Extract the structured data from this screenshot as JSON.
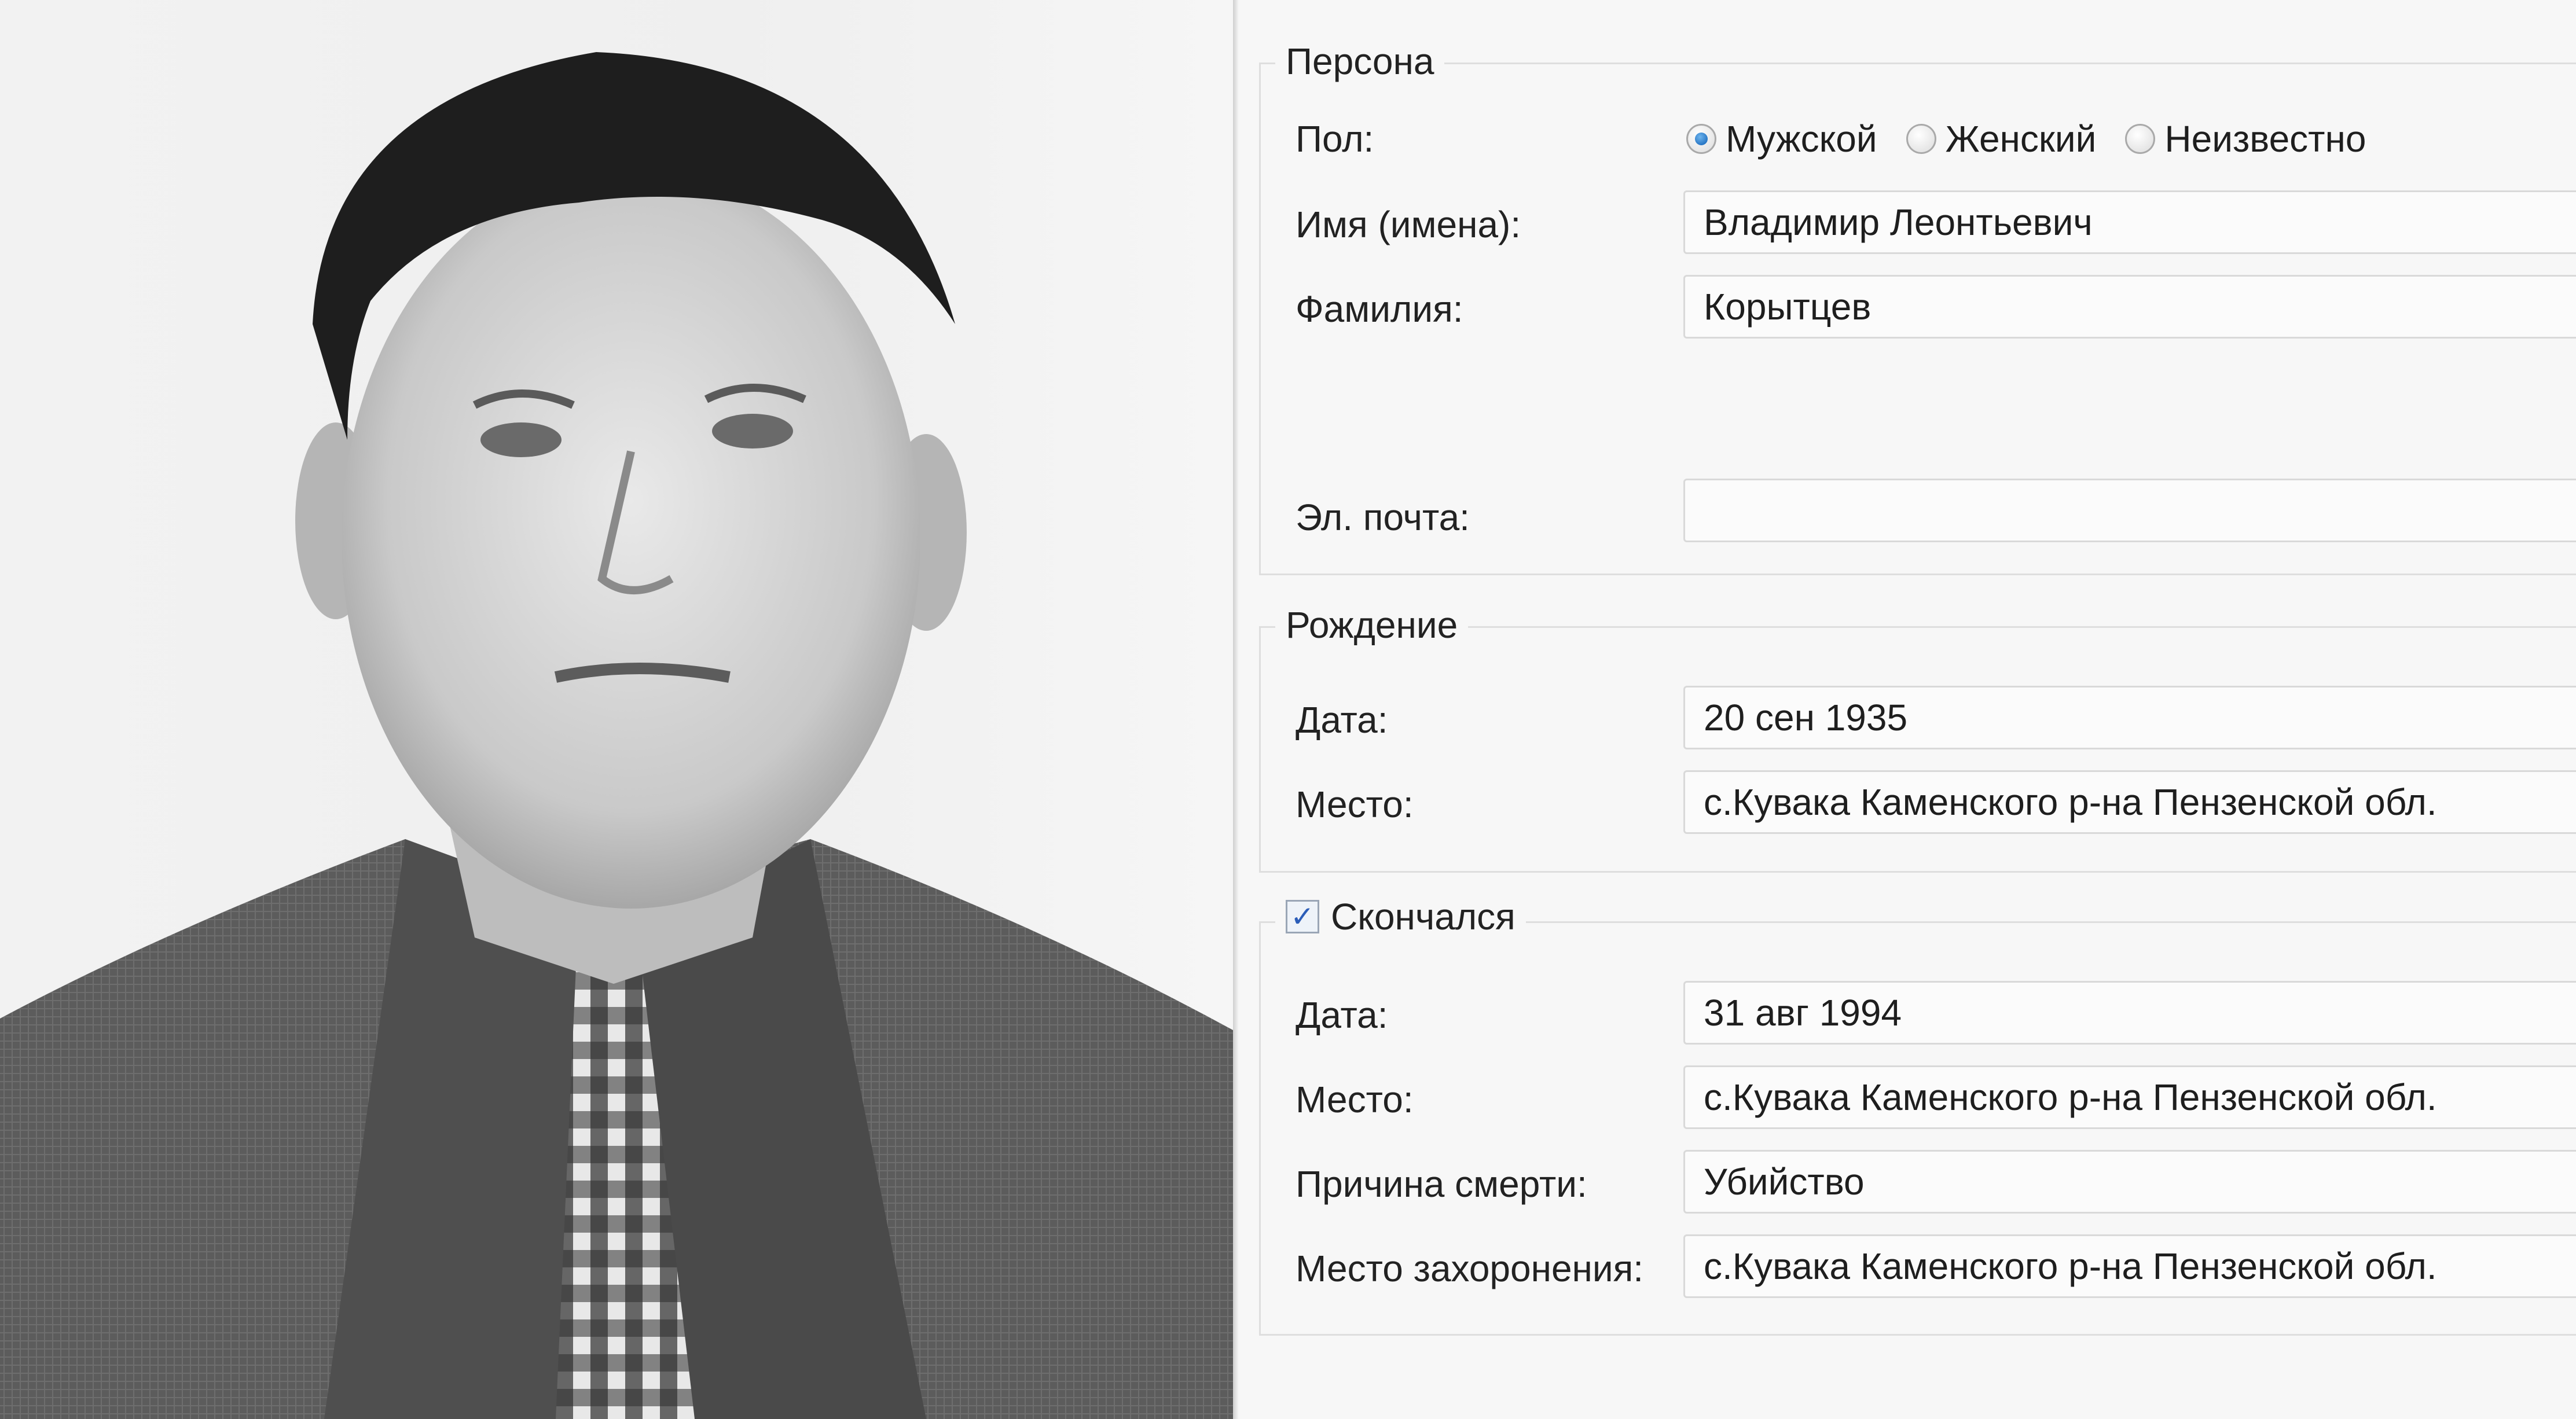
{
  "person_section": {
    "legend": "Персона",
    "gender": {
      "label": "Пол:",
      "options": [
        "Мужской",
        "Женский",
        "Неизвестно"
      ],
      "selected": "Мужской"
    },
    "given_names": {
      "label": "Имя (имена):",
      "value": "Владимир Леонтьевич"
    },
    "surname": {
      "label": "Фамилия:",
      "value": "Корытцев"
    },
    "email": {
      "label": "Эл. почта:",
      "value": ""
    }
  },
  "birth_section": {
    "legend": "Рождение",
    "date": {
      "label": "Дата:",
      "value": "20 сен 1935"
    },
    "place": {
      "label": "Место:",
      "value": "с.Кувака Каменского р-на Пензенской обл."
    }
  },
  "death_section": {
    "legend": "Скончался",
    "deceased_checked": true,
    "checkbox_glyph": "✓",
    "date": {
      "label": "Дата:",
      "value": "31 авг 1994"
    },
    "place": {
      "label": "Место:",
      "value": "с.Кувака Каменского р-на Пензенской обл."
    },
    "cause": {
      "label": "Причина смерти:",
      "value": "Убийство"
    },
    "burial_place": {
      "label": "Место захоронения:",
      "value": "с.Кувака Каменского р-на Пензенской обл."
    }
  },
  "colors": {
    "panel_bg": "#f7f7f7",
    "border": "#d9d9d9",
    "radio_selected": "#1f6fc0",
    "check_mark": "#2b5db8"
  }
}
